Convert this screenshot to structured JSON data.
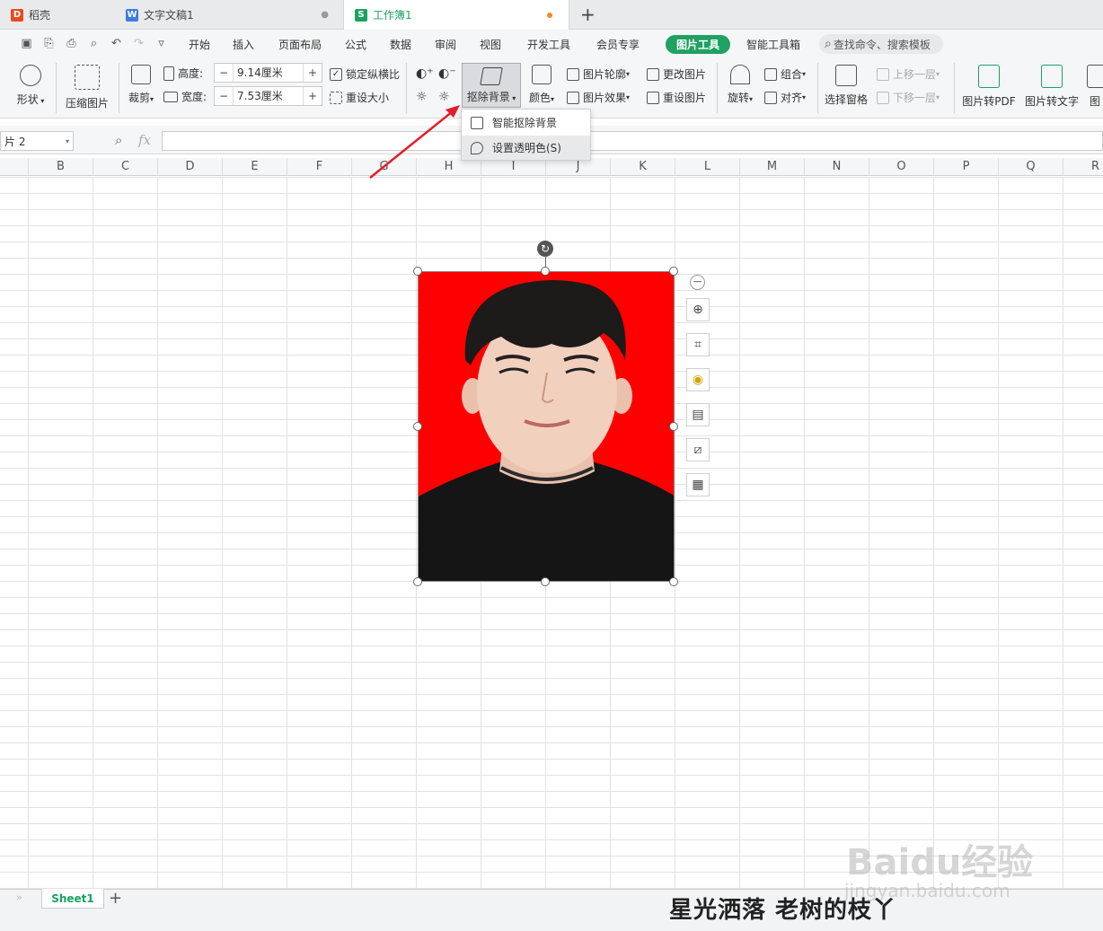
{
  "tabs": [
    {
      "label": "稻壳",
      "icon": "daoke-icon",
      "color": "#e84c1b"
    },
    {
      "label": "文字文稿1",
      "icon": "writer-icon",
      "color": "#3c7de0"
    },
    {
      "label": "工作簿1",
      "icon": "spreadsheet-icon",
      "color": "#1aa260"
    }
  ],
  "new_tab_label": "+",
  "menu": [
    "开始",
    "插入",
    "页面布局",
    "公式",
    "数据",
    "审阅",
    "视图",
    "开发工具",
    "会员专享",
    "图片工具",
    "智能工具箱"
  ],
  "search_placeholder": "查找命令、搜索模板",
  "ribbon": {
    "shape": "形状",
    "compress": "压缩图片",
    "crop": "裁剪",
    "height_label": "高度:",
    "height_value": "9.14厘米",
    "width_label": "宽度:",
    "width_value": "7.53厘米",
    "lock_ratio": "锁定纵横比",
    "reset_size": "重设大小",
    "remove_bg": "抠除背景",
    "color": "颜色",
    "outline": "图片轮廓",
    "effect": "图片效果",
    "change_pic": "更改图片",
    "reset_pic": "重设图片",
    "rotate": "旋转",
    "group": "组合",
    "align": "对齐",
    "select_pane": "选择窗格",
    "bring_forward": "上移一层",
    "send_backward": "下移一层",
    "to_pdf": "图片转PDF",
    "to_text": "图片转文字",
    "more": "图"
  },
  "dropdown": [
    "智能抠除背景",
    "设置透明色(S)"
  ],
  "name_box": "片 2",
  "fx_label": "fx",
  "columns": [
    "B",
    "C",
    "D",
    "E",
    "F",
    "G",
    "H",
    "I",
    "J",
    "K",
    "L",
    "M",
    "N",
    "O",
    "P",
    "Q",
    "R"
  ],
  "sheet_tab": "Sheet1",
  "add_sheet": "+",
  "caption": "星光洒落 老树的枝丫",
  "watermark": "Baidu经验",
  "watermark_url": "jingyan.baidu.com",
  "colors": {
    "accent": "#1aa260",
    "photo_bg": "#ff0000",
    "arrow": "#e0202a"
  }
}
